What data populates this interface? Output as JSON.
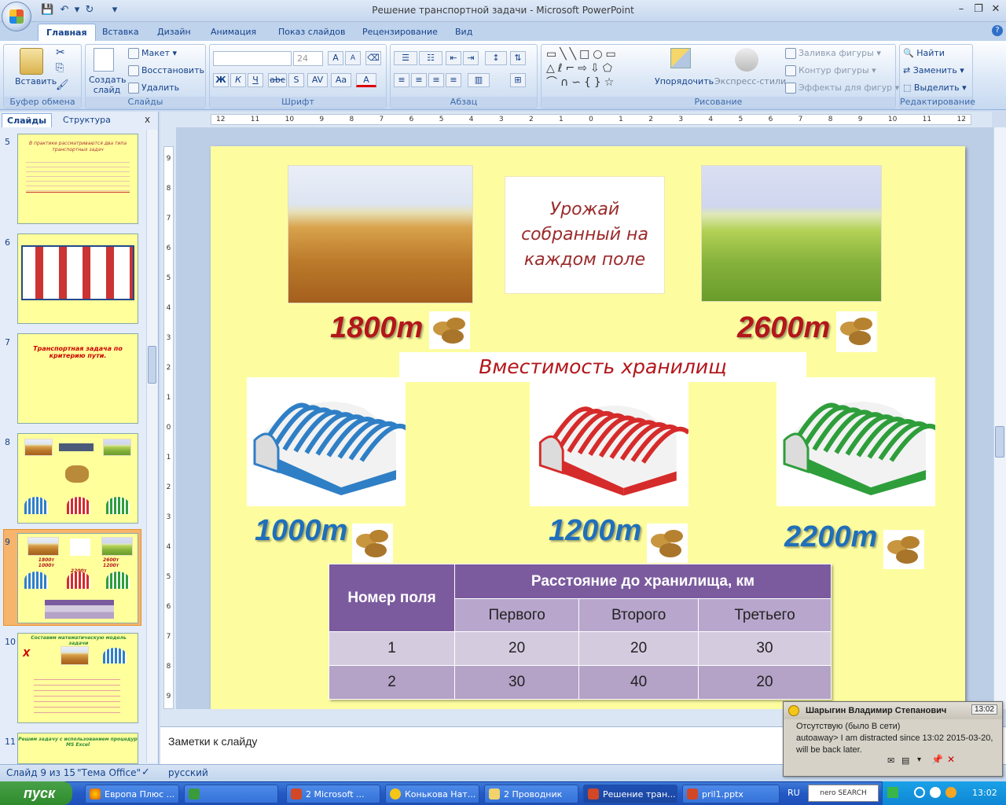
{
  "window": {
    "title": "Решение транспортной задачи - Microsoft PowerPoint",
    "help": "?"
  },
  "ribbon": {
    "tabs": [
      "Главная",
      "Вставка",
      "Дизайн",
      "Анимация",
      "Показ слайдов",
      "Рецензирование",
      "Вид"
    ],
    "active_tab": "Главная",
    "groups": {
      "clipboard": {
        "label": "Буфер обмена",
        "paste": "Вставить"
      },
      "slides": {
        "label": "Слайды",
        "new_slide": "Создать слайд",
        "layout": "Макет",
        "reset": "Восстановить",
        "delete": "Удалить"
      },
      "font": {
        "label": "Шрифт",
        "size": "24",
        "bold": "Ж",
        "italic": "К",
        "underline": "Ч",
        "strike": "abc",
        "shadow": "S",
        "spacing": "AV",
        "case": "Aa",
        "color": "A"
      },
      "paragraph": {
        "label": "Абзац"
      },
      "drawing": {
        "label": "Рисование",
        "arrange": "Упорядочить",
        "quick_styles": "Экспресс-стили",
        "fill": "Заливка фигуры",
        "outline": "Контур фигуры",
        "effects": "Эффекты для фигур"
      },
      "editing": {
        "label": "Редактирование",
        "find": "Найти",
        "replace": "Заменить",
        "select": "Выделить"
      }
    }
  },
  "panel": {
    "tabs": [
      "Слайды",
      "Структура"
    ],
    "close": "x",
    "thumbnails": [
      {
        "num": "5",
        "text": "В практике рассматриваются два типа транспортных задач"
      },
      {
        "num": "6",
        "text": ""
      },
      {
        "num": "7",
        "text": "Транспортная задача по критерию пути."
      },
      {
        "num": "8",
        "text": ""
      },
      {
        "num": "9",
        "text": "1800т 2600т 1000т 1200т 2200т"
      },
      {
        "num": "10",
        "text": "Составим математическую модель задачи"
      },
      {
        "num": "11",
        "text": "Решим задачу с использованием процедур MS Excel"
      }
    ]
  },
  "ruler": {
    "h_marks": [
      "12",
      "11",
      "10",
      "9",
      "8",
      "7",
      "6",
      "5",
      "4",
      "3",
      "2",
      "1",
      "0",
      "1",
      "2",
      "3",
      "4",
      "5",
      "6",
      "7",
      "8",
      "9",
      "10",
      "11",
      "12"
    ],
    "v_marks": [
      "9",
      "8",
      "7",
      "6",
      "5",
      "4",
      "3",
      "2",
      "1",
      "0",
      "1",
      "2",
      "3",
      "4",
      "5",
      "6",
      "7",
      "8",
      "9"
    ]
  },
  "slide": {
    "crop_title": "Урожай собранный на каждом поле",
    "field_amounts": [
      "1800т",
      "2600т"
    ],
    "storage_title": "Вместимость хранилищ",
    "storage_amounts": [
      "1000т",
      "1200т",
      "2200т"
    ],
    "hangar_colors": [
      "#2f7fc6",
      "#d62b2b",
      "#2e9e3b"
    ],
    "table": {
      "col0": "Номер поля",
      "group_header": "Расстояние до хранилища, км",
      "sub_headers": [
        "Первого",
        "Второго",
        "Третьего"
      ],
      "rows": [
        {
          "field": "1",
          "values": [
            "20",
            "20",
            "30"
          ]
        },
        {
          "field": "2",
          "values": [
            "30",
            "40",
            "20"
          ]
        }
      ]
    }
  },
  "notes": {
    "placeholder": "Заметки к слайду"
  },
  "status": {
    "slide": "Слайд 9 из 15",
    "theme": "\"Тема Office\"",
    "language": "русский"
  },
  "taskbar": {
    "start": "пуск",
    "items": [
      "Европа Плюс ...",
      "",
      "2 Microsoft ...",
      "Конькова Нат...",
      "2 Проводник",
      "Решение тран...",
      "pril1.pptx"
    ],
    "lang": "RU",
    "search": "nero SEARCH",
    "time": "13:02"
  },
  "popup": {
    "name": "Шарыгин Владимир Степанович",
    "time": "13:02",
    "status": "Отсутствую (было В сети)",
    "message": "autoaway> I am distracted since 13:02 2015-03-20, will be back later."
  }
}
